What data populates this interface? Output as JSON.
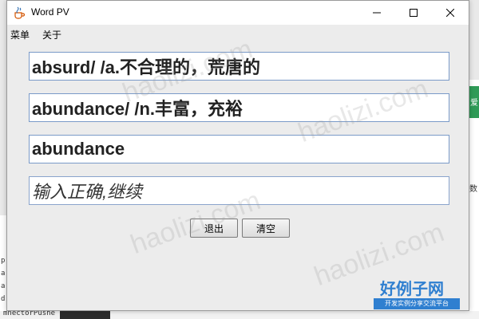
{
  "background": {
    "left_fragments": [
      "p",
      "a",
      "a",
      "d"
    ],
    "bottom_text": "mnectorPushe",
    "right_text": "数",
    "right_tab_text": "爱"
  },
  "window": {
    "title": "Word PV",
    "title_icon": "java-cup-icon",
    "controls": {
      "minimize": "minimize-icon",
      "maximize": "maximize-icon",
      "close": "close-icon"
    }
  },
  "menubar": {
    "items": [
      {
        "label": "菜单"
      },
      {
        "label": "关于"
      }
    ]
  },
  "fields": {
    "word_1": "absurd/ /a.不合理的，荒唐的",
    "word_2": "abundance/ /n.丰富，充裕",
    "input": "abundance",
    "status": "输入正确,继续"
  },
  "buttons": {
    "exit": "退出",
    "clear": "清空"
  },
  "watermark": {
    "site": "haolizi.com",
    "logo_title": "好例子网",
    "logo_subtitle": "开发实例分享交流平台"
  },
  "colors": {
    "field_border": "#7a9ac8",
    "watermark_blue": "#2f7fd0",
    "background_green": "#2f9b57"
  }
}
